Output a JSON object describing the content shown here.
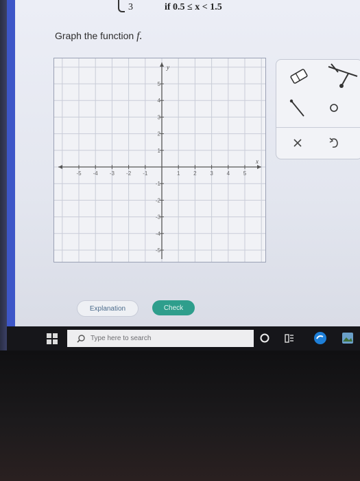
{
  "piecewise": {
    "value": "3",
    "condition": "if 0.5 ≤ x < 1.5"
  },
  "prompt": {
    "text": "Graph the function ",
    "func": "f."
  },
  "graph": {
    "y_label": "y",
    "x_label": "x",
    "x_ticks": [
      "-5",
      "-4",
      "-3",
      "-2",
      "-1",
      "1",
      "2",
      "3",
      "4",
      "5"
    ],
    "y_ticks": [
      "5",
      "4",
      "3",
      "2",
      "1",
      "-1",
      "-2",
      "-3",
      "-4",
      "-5"
    ]
  },
  "tools": {
    "icons": [
      "eraser-icon",
      "ray-tool-icon",
      "segment-tool-icon",
      "open-point-icon",
      "clear-x-icon",
      "undo-icon"
    ]
  },
  "buttons": {
    "explanation": "Explanation",
    "check": "Check"
  },
  "taskbar": {
    "search_placeholder": "Type here to search"
  },
  "colors": {
    "check": "#2e9e8c",
    "accent_bar": "#3d56c8"
  }
}
